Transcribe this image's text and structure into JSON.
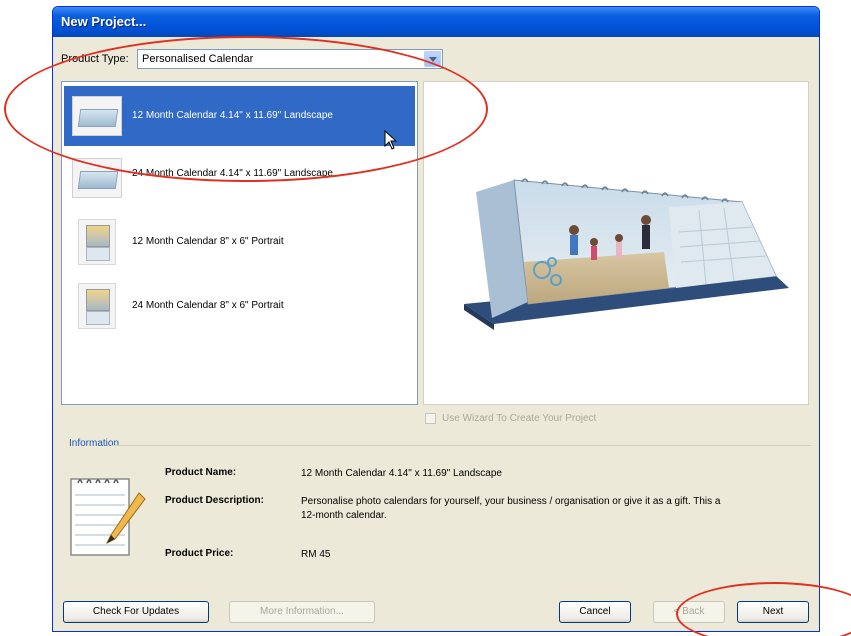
{
  "window": {
    "title": "New Project..."
  },
  "product_type": {
    "label": "Product Type:",
    "selected": "Personalised Calendar"
  },
  "products": [
    {
      "label": "12 Month Calendar  4.14\" x 11.69\" Landscape",
      "selected": true,
      "thumb": "landscape-calendar-thumb"
    },
    {
      "label": "24 Month Calendar  4.14\" x 11.69\" Landscape",
      "selected": false,
      "thumb": "landscape-calendar-thumb"
    },
    {
      "label": "12 Month Calendar 8\" x 6\" Portrait",
      "selected": false,
      "thumb": "portrait-calendar-thumb"
    },
    {
      "label": "24 Month Calendar 8\" x 6\" Portrait",
      "selected": false,
      "thumb": "portrait-calendar-thumb"
    }
  ],
  "wizard_option": {
    "label": "Use Wizard To Create Your Project",
    "checked": false
  },
  "information": {
    "title": "Information",
    "name_label": "Product Name:",
    "name_value": "12 Month Calendar  4.14\" x 11.69\" Landscape",
    "description_label": "Product Description:",
    "description_value": "Personalise photo calendars for yourself, your business / organisation or give it as a gift. This a 12-month calendar.",
    "price_label": "Product Price:",
    "price_value": "RM 45"
  },
  "buttons": {
    "check_updates": "Check For Updates",
    "more_information": "More Information...",
    "cancel": "Cancel",
    "back": "< Back",
    "next": "Next"
  },
  "colors": {
    "selection": "#3169c6",
    "titlebar": "#0053d8",
    "annotation": "#e03020"
  }
}
